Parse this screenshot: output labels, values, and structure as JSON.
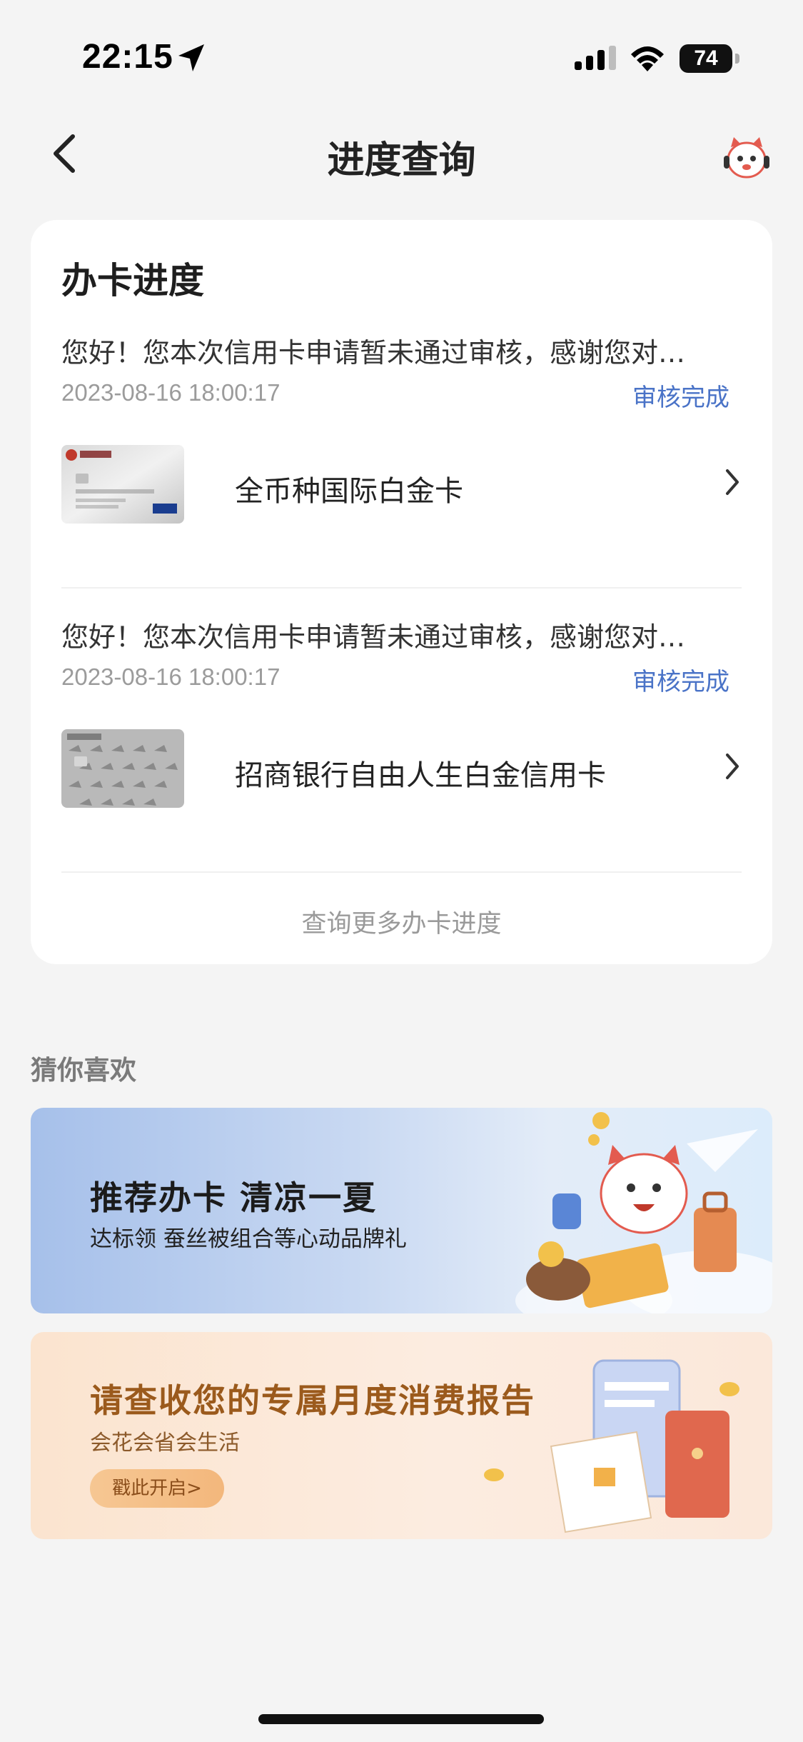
{
  "status_bar": {
    "time": "22:15",
    "battery": "74"
  },
  "nav": {
    "title": "进度查询"
  },
  "progress_card": {
    "title": "办卡进度",
    "records": [
      {
        "message": "您好！您本次信用卡申请暂未通过审核，感谢您对…",
        "time": "2023-08-16 18:00:17",
        "status": "审核完成",
        "card_name": "全币种国际白金卡"
      },
      {
        "message": "您好！您本次信用卡申请暂未通过审核，感谢您对…",
        "time": "2023-08-16 18:00:17",
        "status": "审核完成",
        "card_name": "招商银行自由人生白金信用卡"
      }
    ],
    "more_link": "查询更多办卡进度"
  },
  "recommend": {
    "section_title": "猜你喜欢",
    "banners": [
      {
        "headline": "推荐办卡 清凉一夏",
        "subtitle": "达标领 蚕丝被组合等心动品牌礼"
      },
      {
        "headline": "请查收您的专属月度消费报告",
        "subtitle": "会花会省会生活",
        "button": "戳此开启>"
      }
    ]
  },
  "colors": {
    "status_blue": "#4a73c7",
    "card_bg": "#ffffff",
    "page_bg": "#f4f4f4",
    "banner2_text": "#9b5a1c"
  },
  "icons": [
    "location-arrow-icon",
    "signal-icon",
    "wifi-icon",
    "back-icon",
    "mascot-service-icon",
    "chevron-right-icon"
  ]
}
